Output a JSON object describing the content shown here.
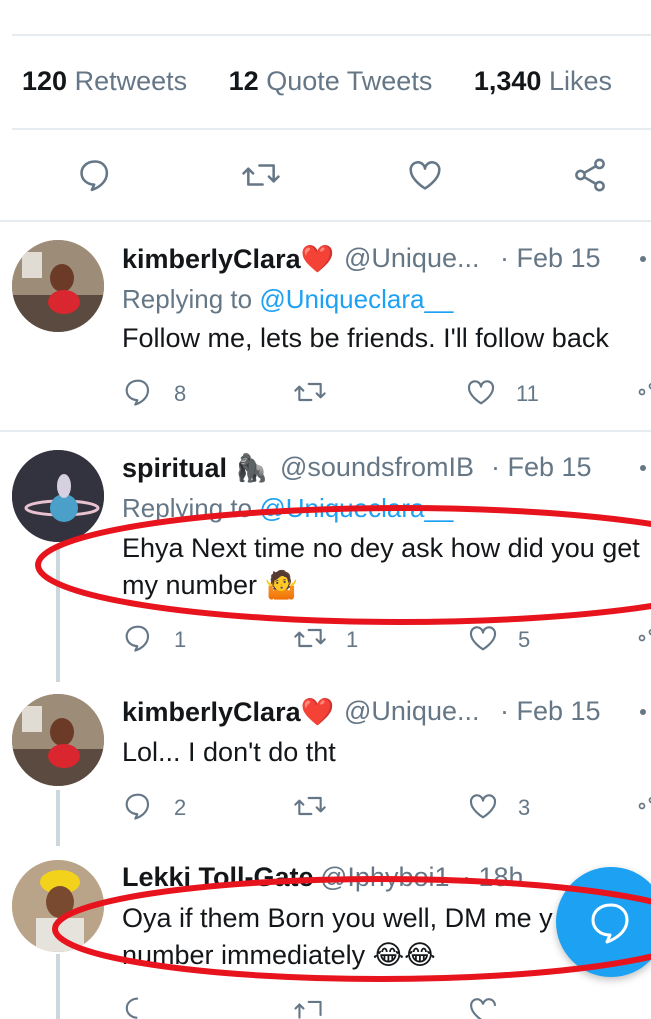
{
  "stats": {
    "retweets_count": "120",
    "retweets_label": "Retweets",
    "quotes_count": "12",
    "quotes_label": "Quote Tweets",
    "likes_count": "1,340",
    "likes_label": "Likes"
  },
  "colors": {
    "accent": "#1da1f2",
    "secondary": "#657786",
    "annotation": "#e8141d"
  },
  "tweets": [
    {
      "name": "kimberlyClara",
      "name_emoji": "❤️",
      "handle": "@Unique...",
      "date": "· Feb 15",
      "reply_prefix": "Replying to",
      "reply_handle": "@Uniqueclara__",
      "text": "Follow me, lets be friends. I'll follow back",
      "replies": "8",
      "retweets": "",
      "likes": "11"
    },
    {
      "name": "spiritual",
      "name_emoji": "🦍",
      "handle": "@soundsfromIB",
      "date": "· Feb 15",
      "reply_prefix": "Replying to",
      "reply_handle": "@Uniqueclara__",
      "text_line1": "Ehya Next time no dey ask how did you get",
      "text_line2": "my number 🤷",
      "replies": "1",
      "retweets": "1",
      "likes": "5"
    },
    {
      "name": "kimberlyClara",
      "name_emoji": "❤️",
      "handle": "@Unique...",
      "date": "· Feb 15",
      "text": "Lol... I don't do tht",
      "replies": "2",
      "retweets": "",
      "likes": "3"
    },
    {
      "name": "Lekki Toll-Gate",
      "handle": "@Iphyboi1",
      "date": "· 18h",
      "text_line1": "Oya if them Born you well, DM me y",
      "text_line2": "number immediately 😂😂"
    }
  ],
  "icons": {
    "reply": "reply-icon",
    "retweet": "retweet-icon",
    "like": "heart-icon",
    "share": "share-icon",
    "compose": "compose-reply-icon",
    "more": "more-icon"
  }
}
